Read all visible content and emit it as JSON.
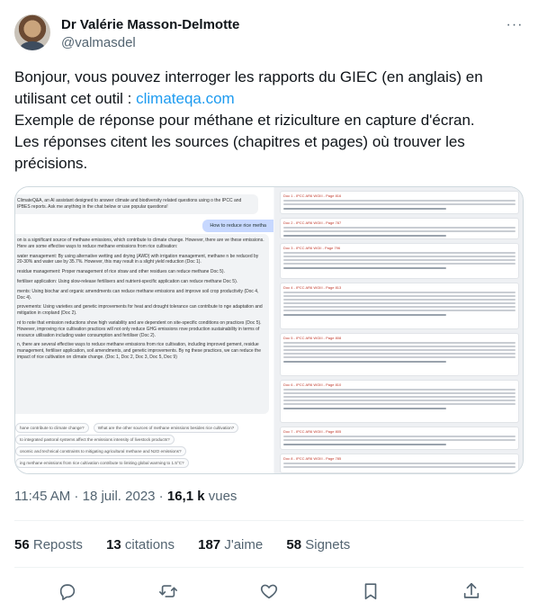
{
  "author": {
    "name": "Dr Valérie Masson-Delmotte",
    "handle": "@valmasdel"
  },
  "tweet": {
    "line1": "Bonjour, vous pouvez interroger les rapports du GIEC (en anglais) en",
    "line2_prefix": "utilisant cet outil : ",
    "link": "climateqa.com",
    "line3": "Exemple de réponse pour méthane et riziculture en capture d'écran.",
    "line4": "Les réponses citent les sources (chapitres et pages) où trouver les",
    "line5": "précisions."
  },
  "media": {
    "intro": "ClimateQ&A, an AI assistant designed to answer climate and biodiversity related questions using o the IPCC and IPBES reports. Ask me anything in the chat below or use popular questions!",
    "query": "How to reduce rice metha",
    "answer": [
      "on is a significant source of methane emissions, which contribute to climate change. However, there are ve these emissions. Here are some effective ways to reduce methane emissions from rice cultivation:",
      "water management: By using alternative wetting and drying (AWD) with irrigation management, methane n be reduced by 20-30% and water use by 35.7%. However, this may result in a slight yield reduction (Doc 1).",
      "residue management: Proper management of rice straw and other residues can reduce methane Doc 5).",
      "fertiliser application: Using slow-release fertilisers and nutrient-specific application can reduce methane Doc 5).",
      "ments: Using biochar and organic amendments can reduce methane emissions and improve soil crop productivity (Doc 4, Doc 4).",
      "provements: Using varieties and genetic improvements for heat and drought tolerance can contribute to nge adaptation and mitigation in cropland (Doc 2).",
      "nt to note that emission reductions show high variability and are dependent on site-specific conditions on practices (Doc 5). However, improving rice cultivation practices will not only reduce GHG emissions rove production sustainability in terms of resource utilisation including water consumption and fertiliser (Doc 2).",
      "n, there are several effective ways to reduce methane emissions from rice cultivation, including improved gement, residue management, fertiliser application, soil amendments, and genetic improvements. By ng these practices, we can reduce the impact of rice cultivation on climate change. (Doc 1, Doc 2, Doc 3, Doc 5, Doc 9)"
    ],
    "suggestions": [
      "hane contribute to climate change?",
      "What are the other sources of methane emissions besides rice cultivation?",
      "to integrated pastoral systems affect the emissions intensity of livestock products?",
      "onomic and technical constraints to mitigating agricultural methane and N2O emissions?",
      "ing methane emissions from rice cultivation contribute to limiting global warming to 1.5°C?"
    ],
    "doc_titles": [
      "Doc 1 - IPCC AR6 WGIII - Page 816",
      "Doc 2 - IPCC AR6 WGIII - Page 787",
      "Doc 3 - IPCC AR6 WGII - Page 796",
      "Doc 4 - IPCC AR6 WGIII - Page 813",
      "Doc 5 - IPCC AR6 WGIII - Page 808",
      "Doc 6 - IPCC AR6 WGIII - Page 810",
      "Doc 7 - IPCC AR6 WGIII - Page 805",
      "Doc 8 - IPCC AR6 WGIII - Page 785"
    ]
  },
  "meta": {
    "time": "11:45 AM",
    "sep": " · ",
    "date": "18 juil. 2023",
    "views_count": "16,1 k",
    "views_label": " vues"
  },
  "stats": {
    "reposts_count": "56",
    "reposts_label": " Reposts",
    "quotes_count": "13",
    "quotes_label": " citations",
    "likes_count": "187",
    "likes_label": " J'aime",
    "bookmarks_count": "58",
    "bookmarks_label": " Signets"
  },
  "colors": {
    "link": "#1d9bf0",
    "muted": "#536471",
    "text": "#0f1419",
    "border": "#eff3f4"
  }
}
